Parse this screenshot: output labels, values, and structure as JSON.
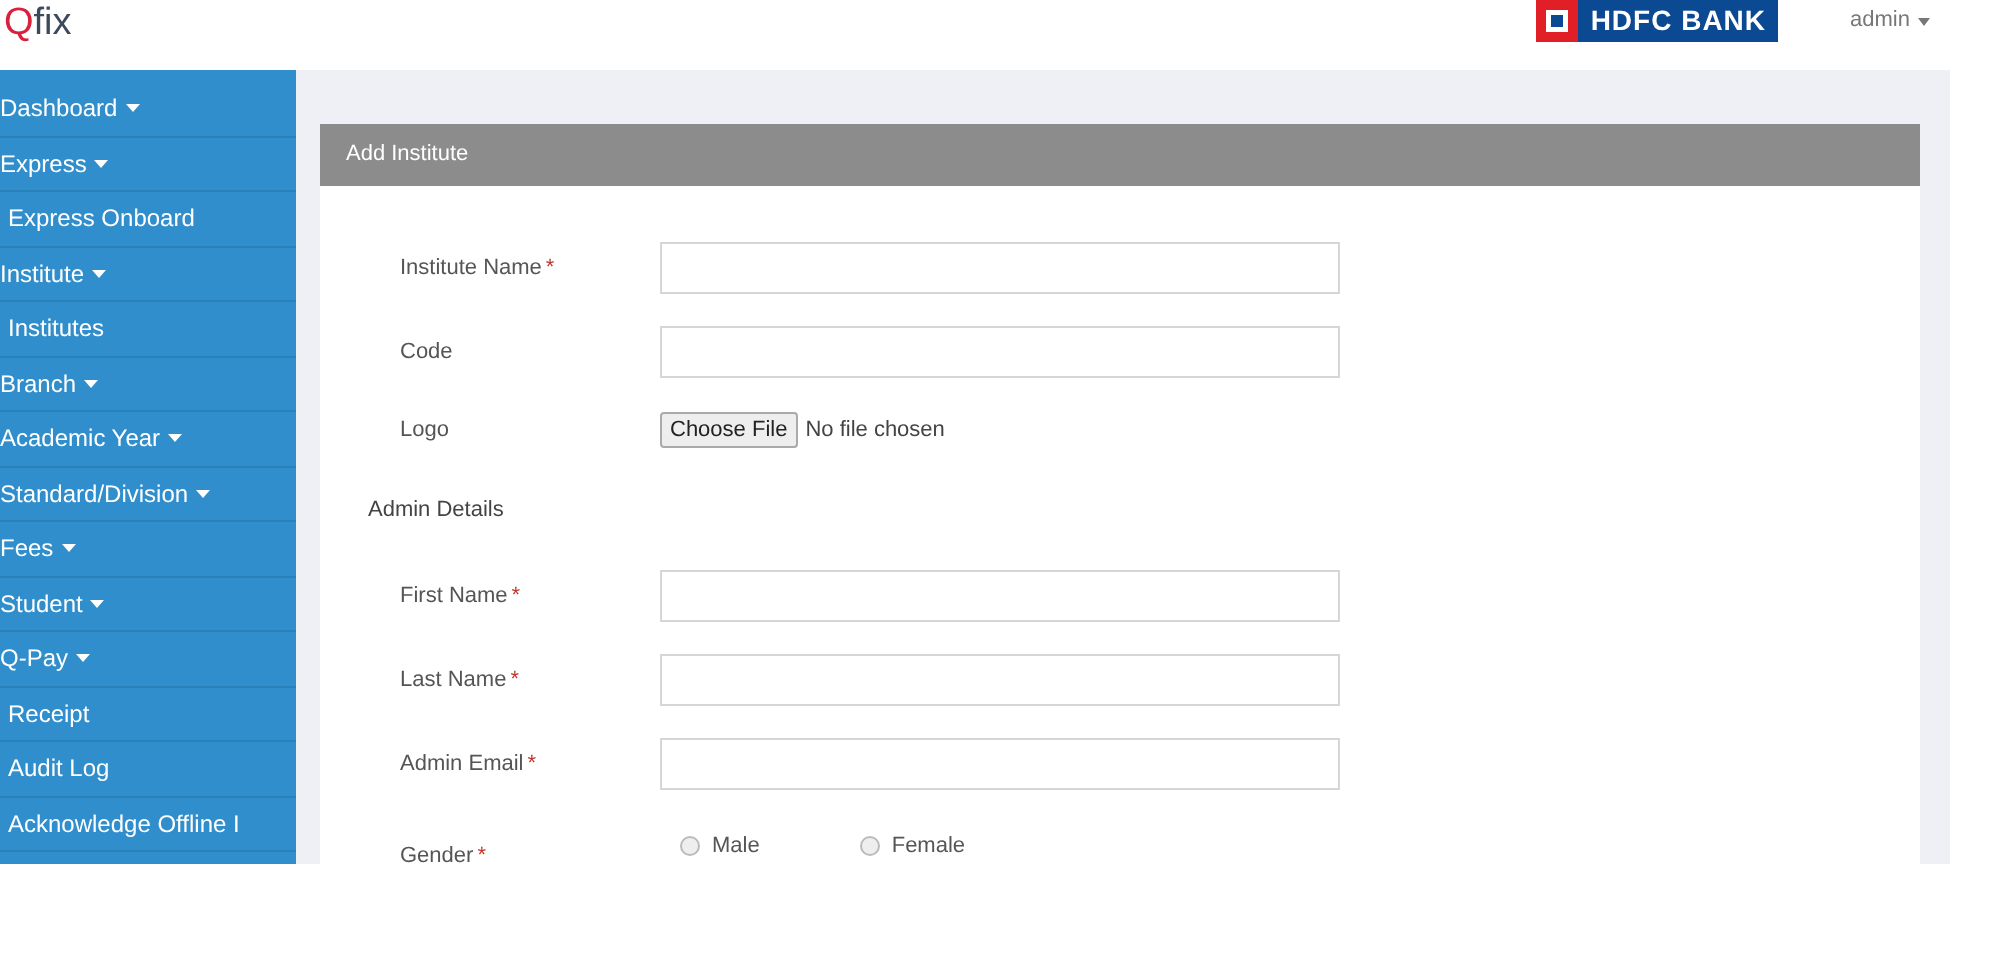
{
  "header": {
    "logo": {
      "mark": "Q",
      "text": "fix"
    },
    "bank": "HDFC BANK",
    "user": "admin"
  },
  "sidebar": {
    "items": [
      {
        "label": "Dashboard",
        "kind": "menu"
      },
      {
        "label": "Express",
        "kind": "menu"
      },
      {
        "label": "Express Onboard",
        "kind": "link"
      },
      {
        "label": "Institute",
        "kind": "menu"
      },
      {
        "label": "Institutes",
        "kind": "link"
      },
      {
        "label": "Branch",
        "kind": "menu"
      },
      {
        "label": "Academic Year",
        "kind": "menu"
      },
      {
        "label": "Standard/Division",
        "kind": "menu"
      },
      {
        "label": "Fees",
        "kind": "menu"
      },
      {
        "label": "Student",
        "kind": "menu"
      },
      {
        "label": "Q-Pay",
        "kind": "menu"
      },
      {
        "label": "Receipt",
        "kind": "link"
      },
      {
        "label": "Audit Log",
        "kind": "link"
      },
      {
        "label": "Acknowledge Offline I",
        "kind": "link"
      }
    ]
  },
  "panel": {
    "title": "Add Institute",
    "fields": [
      {
        "kind": "text",
        "label": "Institute Name",
        "asterisk": "*"
      },
      {
        "kind": "text",
        "label": "Code"
      },
      {
        "kind": "file",
        "label": "Logo",
        "button": "Choose File",
        "status": "No file chosen"
      },
      {
        "kind": "section",
        "label": "Admin Details"
      },
      {
        "kind": "text",
        "label": "First Name",
        "asterisk": "*"
      },
      {
        "kind": "text",
        "label": "Last Name",
        "asterisk": "*"
      },
      {
        "kind": "text",
        "label": "Admin Email",
        "asterisk": "*"
      },
      {
        "kind": "radio",
        "label": "Gender",
        "asterisk": "*",
        "options": [
          {
            "label": "Male",
            "selected": false
          },
          {
            "label": "Female",
            "selected": false
          }
        ]
      }
    ]
  }
}
